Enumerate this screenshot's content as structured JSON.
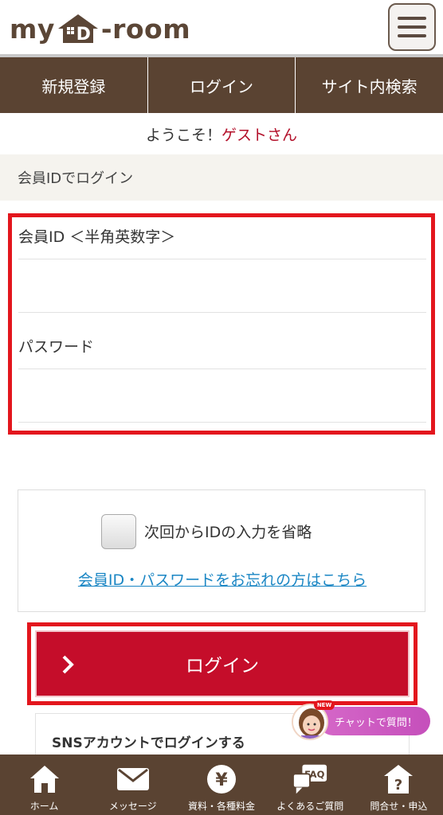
{
  "header": {
    "logo_left": "my",
    "logo_mid": "D",
    "logo_right": "-room"
  },
  "nav": {
    "items": [
      {
        "label": "新規登録"
      },
      {
        "label": "ログイン"
      },
      {
        "label": "サイト内検索"
      }
    ]
  },
  "welcome": {
    "prefix": "ようこそ！",
    "guest": "ゲストさん"
  },
  "section": {
    "title": "会員IDでログイン"
  },
  "form": {
    "id_label": "会員ID ＜半角英数字＞",
    "id_value": "",
    "password_label": "パスワード",
    "password_value": ""
  },
  "remember": {
    "label": "次回からIDの入力を省略",
    "forgot_link": "会員ID・パスワードをお忘れの方はこちら"
  },
  "login_button": {
    "label": "ログイン"
  },
  "sns": {
    "label": "SNSアカウントでログインする"
  },
  "chat": {
    "label": "チャットで質問！",
    "badge": "NEW"
  },
  "bottom_bar": {
    "items": [
      {
        "label": "ホーム",
        "icon": "home-icon"
      },
      {
        "label": "メッセージ",
        "icon": "mail-icon"
      },
      {
        "label": "資料・各種料金",
        "icon": "yen-icon"
      },
      {
        "label": "よくあるご質問",
        "icon": "faq-icon"
      },
      {
        "label": "問合せ・申込",
        "icon": "question-icon"
      }
    ],
    "icon_text": {
      "yen": "¥",
      "faq": "FAQ",
      "question": "?"
    }
  },
  "colors": {
    "brown": "#5a4332",
    "accent_red": "#c50d2a",
    "highlight_red": "#e3161d",
    "link_blue": "#1a86c4",
    "chat_pink": "#d567c8"
  }
}
